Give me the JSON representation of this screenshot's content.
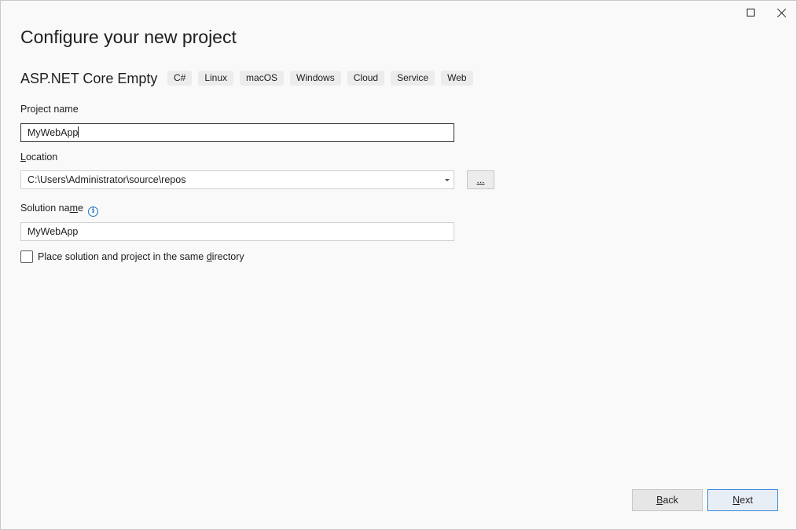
{
  "window": {
    "controls": {
      "maximize_icon": "maximize-icon",
      "close_icon": "close-icon"
    }
  },
  "header": {
    "title": "Configure your new project",
    "template_name": "ASP.NET Core Empty",
    "tags": [
      "C#",
      "Linux",
      "macOS",
      "Windows",
      "Cloud",
      "Service",
      "Web"
    ]
  },
  "form": {
    "project_name": {
      "label": "Project name",
      "value": "MyWebApp"
    },
    "location": {
      "label_mnemonic": "L",
      "label_rest": "ocation",
      "value": "C:\\Users\\Administrator\\source\\repos",
      "browse_label": "..."
    },
    "solution_name": {
      "label_before": "Solution na",
      "label_mnemonic": "m",
      "label_after": "e",
      "info_icon": "info-icon",
      "value": "MyWebApp"
    },
    "same_directory": {
      "label_before": "Place solution and project in the same ",
      "label_mnemonic": "d",
      "label_after": "irectory",
      "checked": false
    }
  },
  "footer": {
    "back": {
      "mnemonic": "B",
      "rest": "ack"
    },
    "next": {
      "mnemonic": "N",
      "rest": "ext"
    }
  },
  "colors": {
    "background": "#f9f9f9",
    "accent": "#1f74c4",
    "tag_background": "#ececec"
  }
}
